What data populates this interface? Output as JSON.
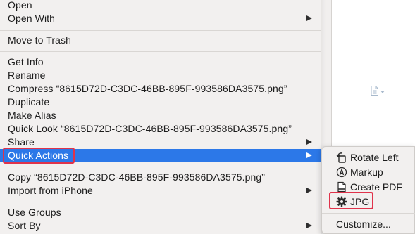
{
  "context_menu": {
    "items": [
      {
        "label": "Open"
      },
      {
        "label": "Open With",
        "has_submenu": true
      },
      {
        "label": "Move to Trash"
      },
      {
        "label": "Get Info"
      },
      {
        "label": "Rename"
      },
      {
        "label": "Compress “8615D72D-C3DC-46BB-895F-993586DA3575.png”"
      },
      {
        "label": "Duplicate"
      },
      {
        "label": "Make Alias"
      },
      {
        "label": "Quick Look “8615D72D-C3DC-46BB-895F-993586DA3575.png”"
      },
      {
        "label": "Share",
        "has_submenu": true
      },
      {
        "label": "Quick Actions",
        "has_submenu": true,
        "selected": true
      },
      {
        "label": "Copy “8615D72D-C3DC-46BB-895F-993586DA3575.png”"
      },
      {
        "label": "Import from iPhone",
        "has_submenu": true
      },
      {
        "label": "Use Groups"
      },
      {
        "label": "Sort By",
        "has_submenu": true
      }
    ]
  },
  "quick_actions_submenu": {
    "items": [
      {
        "label": "Rotate Left",
        "icon": "rotate-left-icon"
      },
      {
        "label": "Markup",
        "icon": "markup-icon"
      },
      {
        "label": "Create PDF",
        "icon": "pdf-icon"
      },
      {
        "label": "JPG",
        "icon": "gear-icon"
      }
    ],
    "customize_label": "Customize..."
  },
  "colors": {
    "selection": "#2c78e8",
    "annotation": "#e0334b",
    "menu_bg": "#f2f0ef"
  }
}
